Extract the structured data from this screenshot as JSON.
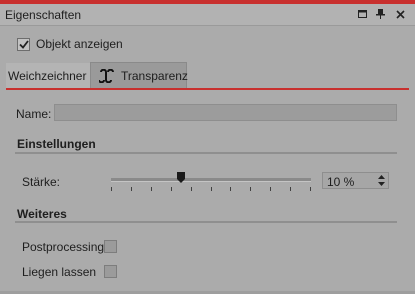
{
  "window": {
    "title": "Eigenschaften",
    "accent_color": "#c8302e",
    "controls": [
      "maximize-icon",
      "pin-icon",
      "close-icon"
    ]
  },
  "show_object": {
    "label": "Objekt anzeigen",
    "checked": true
  },
  "tabs": [
    {
      "label": "Weichzeichner",
      "active": true
    },
    {
      "label": "Transparenz",
      "active": false,
      "icon": "transparency-icon"
    }
  ],
  "name_field": {
    "label": "Name:",
    "value": ""
  },
  "sections": {
    "settings": {
      "title": "Einstellungen",
      "strength": {
        "label": "Stärke:",
        "value": "10 %",
        "slider_percent": 35
      }
    },
    "more": {
      "title": "Weiteres",
      "options": [
        {
          "label": "Postprocessing",
          "checked": false
        },
        {
          "label": "Liegen lassen",
          "checked": false
        }
      ]
    }
  }
}
